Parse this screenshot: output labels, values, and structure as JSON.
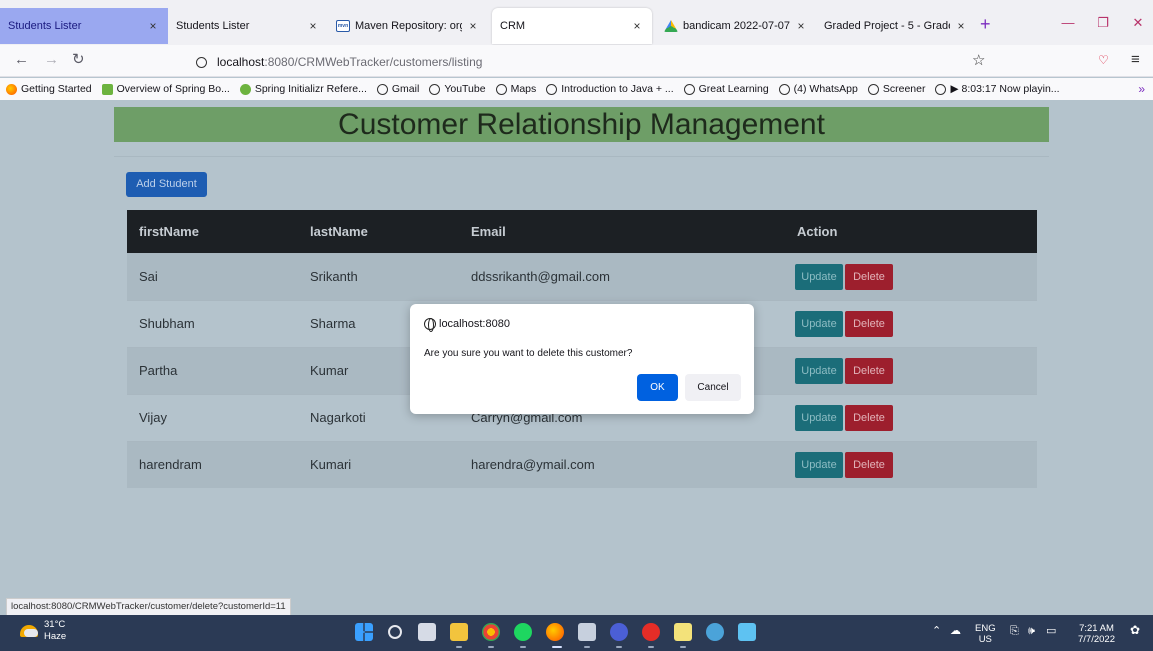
{
  "browser": {
    "tabs": [
      {
        "label": "Students Lister",
        "close": "×"
      },
      {
        "label": "Students Lister",
        "close": "×"
      },
      {
        "label": "Maven Repository: org.sp",
        "close": "×"
      },
      {
        "label": "CRM",
        "close": "×"
      },
      {
        "label": "bandicam 2022-07-07 06-",
        "close": "×"
      },
      {
        "label": "Graded Project - 5 - Graded A",
        "close": "×"
      }
    ],
    "url_host": "localhost",
    "url_path": ":8080/CRMWebTracker/customers/listing",
    "bookmarks": [
      "Getting Started",
      "Overview of Spring Bo...",
      "Spring Initializr Refere...",
      "Gmail",
      "YouTube",
      "Maps",
      "Introduction to Java + ...",
      "Great Learning",
      "(4) WhatsApp",
      "Screener",
      "▶ 8:03:17 Now playin..."
    ]
  },
  "page": {
    "title": "Customer Relationship Management",
    "add_button": "Add Student",
    "table": {
      "headers": [
        "firstName",
        "lastName",
        "Email",
        "Action"
      ],
      "rows": [
        {
          "first": "Sai",
          "last": "Srikanth",
          "email": "ddssrikanth@gmail.com"
        },
        {
          "first": "Shubham",
          "last": "Sharma",
          "email": ""
        },
        {
          "first": "Partha",
          "last": "Kumar",
          "email": ""
        },
        {
          "first": "Vijay",
          "last": "Nagarkoti",
          "email": "Carryn@gmail.com"
        },
        {
          "first": "harendram",
          "last": "Kumari",
          "email": "harendra@ymail.com"
        }
      ],
      "update_label": "Update",
      "delete_label": "Delete"
    },
    "status_url": "localhost:8080/CRMWebTracker/customer/delete?customerId=11"
  },
  "dialog": {
    "origin": "localhost:8080",
    "message": "Are you sure you want to delete this customer?",
    "ok": "OK",
    "cancel": "Cancel"
  },
  "taskbar": {
    "temperature": "31°C",
    "condition": "Haze",
    "lang": "ENG",
    "region": "US",
    "time": "7:21 AM",
    "date": "7/7/2022"
  }
}
